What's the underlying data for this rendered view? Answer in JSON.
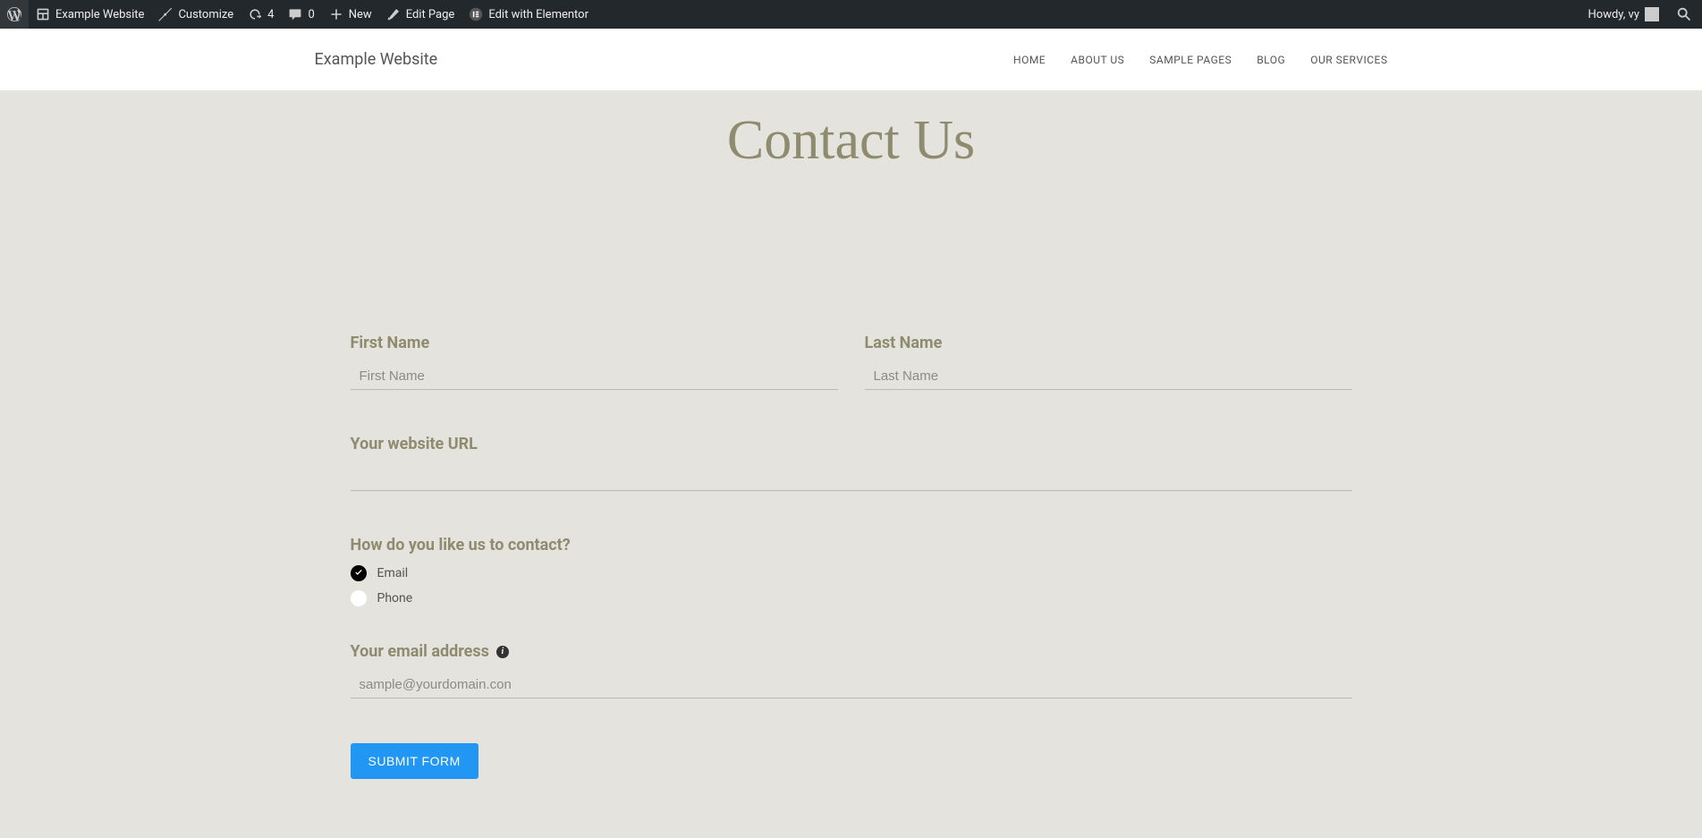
{
  "adminBar": {
    "siteName": "Example Website",
    "customize": "Customize",
    "updateCount": "4",
    "commentCount": "0",
    "newLabel": "New",
    "editPage": "Edit Page",
    "editElementor": "Edit with Elementor",
    "greeting": "Howdy, vy"
  },
  "siteHeader": {
    "title": "Example Website",
    "nav": {
      "home": "HOME",
      "about": "ABOUT US",
      "samples": "SAMPLE PAGES",
      "blog": "BLOG",
      "services": "OUR SERVICES"
    }
  },
  "page": {
    "title": "Contact Us"
  },
  "form": {
    "firstName": {
      "label": "First Name",
      "placeholder": "First Name"
    },
    "lastName": {
      "label": "Last Name",
      "placeholder": "Last Name"
    },
    "websiteUrl": {
      "label": "Your website URL"
    },
    "contactMethod": {
      "label": "How do you like us to contact?",
      "optionEmail": "Email",
      "optionPhone": "Phone"
    },
    "emailAddress": {
      "label": "Your email address",
      "placeholder": "sample@yourdomain.con"
    },
    "submitLabel": "SUBMIT FORM"
  }
}
